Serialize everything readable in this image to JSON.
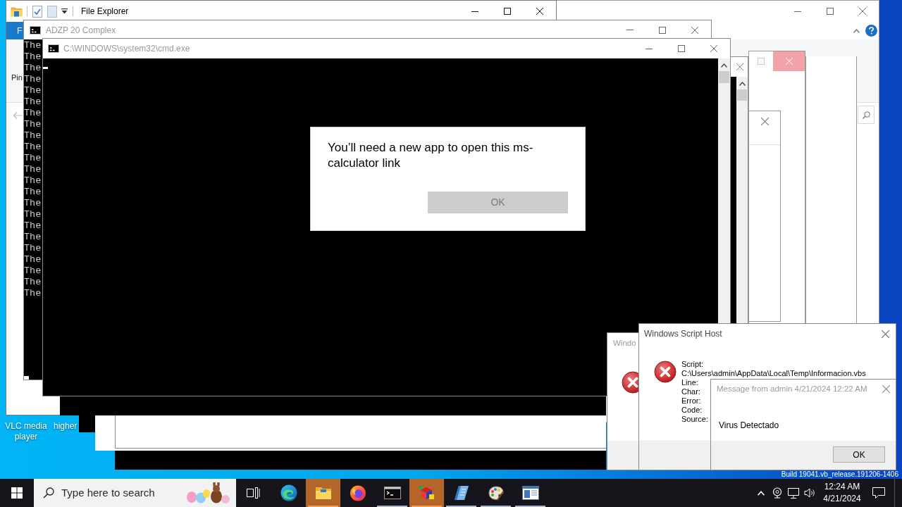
{
  "desktop": {
    "icons": [
      {
        "label": "VLC media player"
      },
      {
        "label": "higher"
      }
    ],
    "build_text": "Build 19041.vb_release.191206-1406"
  },
  "explorer_window": {
    "title": "File Explorer",
    "file_tab": "F",
    "ribbon_label": "Pin"
  },
  "console_window": {
    "title": "ADZP 20 Complex",
    "lines": [
      "The",
      "The",
      "The",
      "The",
      "The",
      "The",
      "The",
      "The",
      "The",
      "The",
      "The",
      "The",
      "The",
      "The",
      "The",
      "The",
      "The",
      "The",
      "The",
      "The",
      "The",
      "The",
      "The"
    ]
  },
  "cmd_window": {
    "title": "C:\\WINDOWS\\system32\\cmd.exe"
  },
  "app_dialog": {
    "message": "You’ll need a new app to open this ms-calculator link",
    "button": {
      "label": "OK",
      "disabled": true
    }
  },
  "error_dialog": {
    "title": "Windo"
  },
  "script_host_dialog": {
    "title": "Windows Script Host",
    "lines": [
      "Script:",
      "C:\\Users\\admin\\AppData\\Local\\Temp\\Informacion.vbs",
      "Line:",
      "Char:",
      "Error:",
      "Code:",
      "Source:"
    ]
  },
  "message_dialog": {
    "title": "Message from admin 4/21/2024 12:22 AM",
    "message": "Virus Detectado",
    "button": "OK"
  },
  "taskbar": {
    "search": {
      "placeholder": "Type here to search"
    },
    "apps": [
      {
        "running": false,
        "flashing": false
      },
      {
        "running": true,
        "flashing": true
      },
      {
        "running": false,
        "flashing": false
      },
      {
        "running": true,
        "flashing": false
      },
      {
        "running": true,
        "flashing": true
      },
      {
        "running": true,
        "flashing": false
      },
      {
        "running": true,
        "flashing": false
      },
      {
        "running": true,
        "flashing": false
      }
    ],
    "clock": {
      "time": "12:24 AM",
      "date": "4/21/2024"
    }
  }
}
